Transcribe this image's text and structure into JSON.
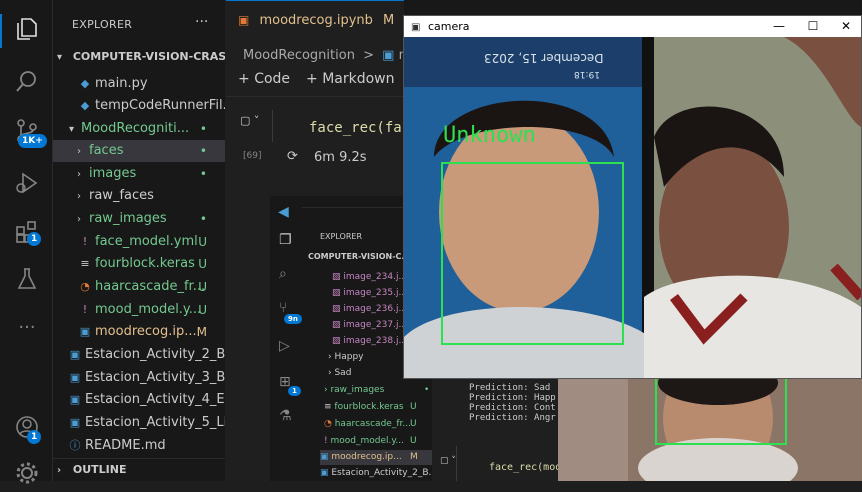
{
  "activity": {
    "source_control_badge": "1K+",
    "extensions_badge": "1",
    "account_badge": "1"
  },
  "sidebar": {
    "title": "EXPLORER",
    "more": "···",
    "root": "COMPUTER-VISION-CRAS...",
    "items": [
      {
        "label": "main.py",
        "icon": "python-icon",
        "status": ""
      },
      {
        "label": "tempCodeRunnerFil...",
        "icon": "python-icon",
        "status": ""
      },
      {
        "label": "MoodRecogniti...",
        "icon": "folder-icon",
        "status": "•"
      },
      {
        "label": "faces",
        "icon": "folder-icon",
        "status": "•"
      },
      {
        "label": "images",
        "icon": "folder-icon",
        "status": "•"
      },
      {
        "label": "raw_faces",
        "icon": "folder-icon",
        "status": ""
      },
      {
        "label": "raw_images",
        "icon": "folder-icon",
        "status": "•"
      },
      {
        "label": "face_model.yml",
        "icon": "yaml-icon",
        "status": "U"
      },
      {
        "label": "fourblock.keras",
        "icon": "file-icon",
        "status": "U"
      },
      {
        "label": "haarcascade_fr...",
        "icon": "rss-icon",
        "status": "U"
      },
      {
        "label": "mood_model.y...",
        "icon": "yaml-icon",
        "status": "U"
      },
      {
        "label": "moodrecog.ip...",
        "icon": "notebook-icon",
        "status": "M"
      },
      {
        "label": "Estacion_Activity_2_B...",
        "icon": "notebook-icon",
        "status": ""
      },
      {
        "label": "Estacion_Activity_3_B...",
        "icon": "notebook-icon",
        "status": ""
      },
      {
        "label": "Estacion_Activity_4_E...",
        "icon": "notebook-icon",
        "status": ""
      },
      {
        "label": "Estacion_Activity_5_Li...",
        "icon": "notebook-icon",
        "status": ""
      },
      {
        "label": "README.md",
        "icon": "info-icon",
        "status": ""
      }
    ],
    "outline": "OUTLINE"
  },
  "editor": {
    "tab_label": "moodrecog.ipynb",
    "tab_status": "M",
    "breadcrumb_folder": "MoodRecognition",
    "breadcrumb_sep": ">",
    "breadcrumb_file": "mo",
    "add_code": "Code",
    "add_markdown": "Markdown",
    "cell_code": "face_rec(fac",
    "cell_exec_count": "[69]",
    "cell_time": "6m 9.2s"
  },
  "inner": {
    "explorer": "EXPLORER",
    "root": "COMPUTER-VISION-C...",
    "sc_badge": "9n",
    "ext_badge": "1",
    "rows": [
      {
        "label": "image_234.j...",
        "status": ""
      },
      {
        "label": "image_235.j...",
        "status": ""
      },
      {
        "label": "image_236.j...",
        "status": ""
      },
      {
        "label": "image_237.j...",
        "status": ""
      },
      {
        "label": "image_238.j...",
        "status": ""
      },
      {
        "label": "Happy",
        "status": ""
      },
      {
        "label": "Sad",
        "status": ""
      },
      {
        "label": "raw_images",
        "status": "•"
      },
      {
        "label": "fourblock.keras",
        "status": "U"
      },
      {
        "label": "haarcascade_fr...",
        "status": "U"
      },
      {
        "label": "mood_model.y...",
        "status": "U"
      },
      {
        "label": "moodrecog.ip...",
        "status": "M"
      },
      {
        "label": "Estacion_Activity_2_B...",
        "status": ""
      }
    ],
    "output_lines": [
      "Prediction: Sad",
      "Prediction: Happ",
      "Prediction: Cont",
      "Prediction: Angr"
    ],
    "inner_code": "face_rec(mod"
  },
  "camera": {
    "title": "camera",
    "minimize": "—",
    "maximize": "☐",
    "close": "✕",
    "face_label": "Unknown",
    "phone_date": "December 15, 2023",
    "phone_time": "19:18"
  }
}
